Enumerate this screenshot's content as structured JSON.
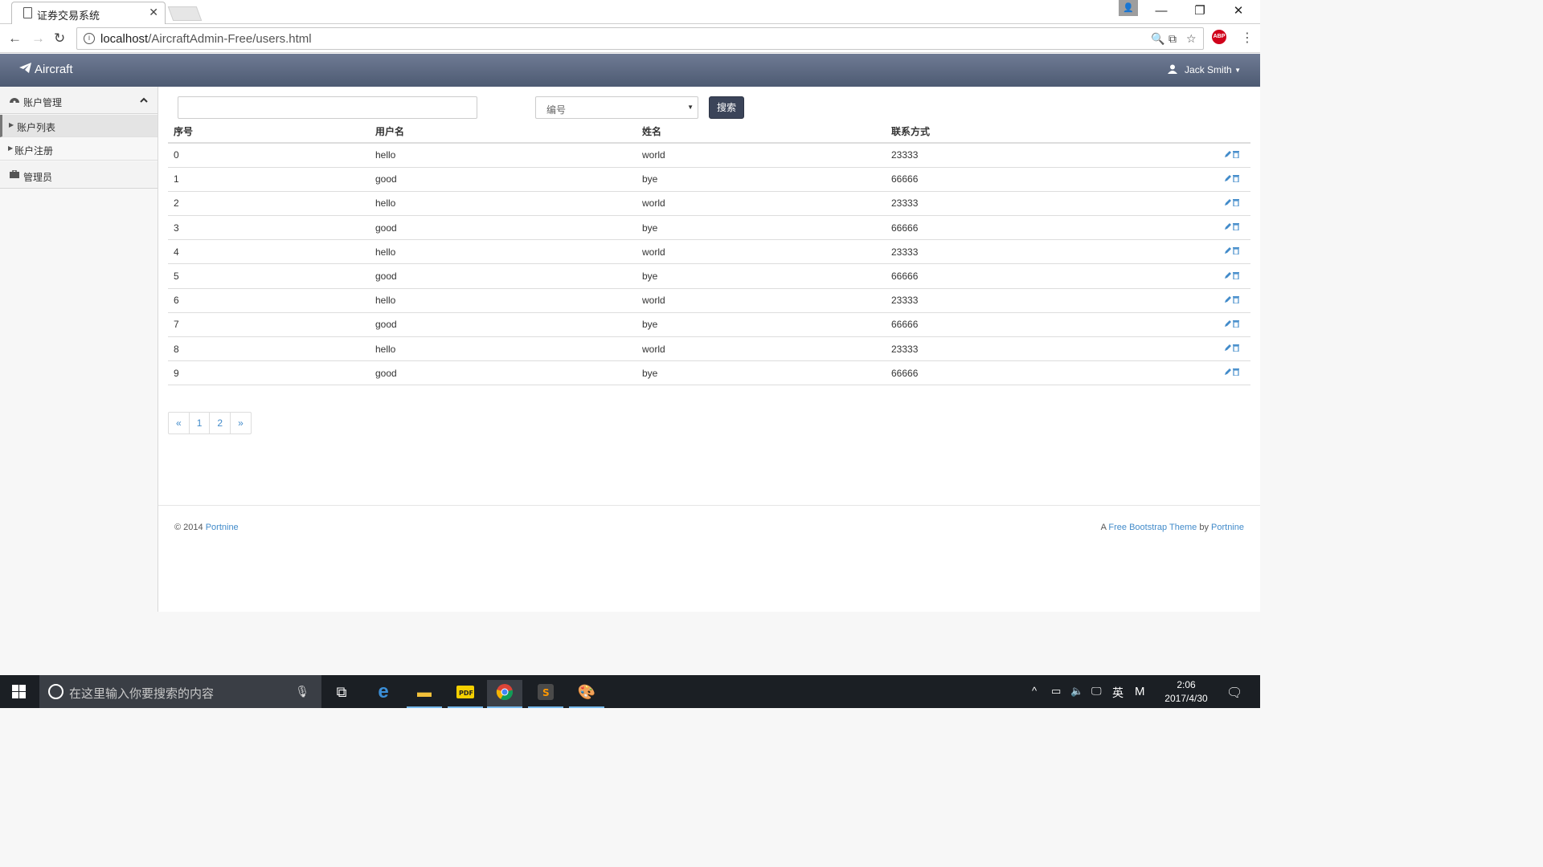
{
  "browser": {
    "tab_title": "证券交易系统",
    "url_host": "localhost",
    "url_path": "/AircraftAdmin-Free/users.html"
  },
  "header": {
    "brand": "Aircraft",
    "user_name": "Jack Smith"
  },
  "sidebar": {
    "groups": [
      {
        "label": "账户管理",
        "items": [
          {
            "label": "账户列表",
            "active": true
          },
          {
            "label": "账户注册",
            "active": false
          }
        ]
      },
      {
        "label": "管理员"
      }
    ]
  },
  "search": {
    "input_value": "",
    "select_value": "编号",
    "button_label": "搜索"
  },
  "table": {
    "headers": [
      "序号",
      "用户名",
      "姓名",
      "联系方式"
    ],
    "rows": [
      [
        "0",
        "hello",
        "world",
        "23333"
      ],
      [
        "1",
        "good",
        "bye",
        "66666"
      ],
      [
        "2",
        "hello",
        "world",
        "23333"
      ],
      [
        "3",
        "good",
        "bye",
        "66666"
      ],
      [
        "4",
        "hello",
        "world",
        "23333"
      ],
      [
        "5",
        "good",
        "bye",
        "66666"
      ],
      [
        "6",
        "hello",
        "world",
        "23333"
      ],
      [
        "7",
        "good",
        "bye",
        "66666"
      ],
      [
        "8",
        "hello",
        "world",
        "23333"
      ],
      [
        "9",
        "good",
        "bye",
        "66666"
      ]
    ]
  },
  "pagination": [
    "«",
    "1",
    "2",
    "»"
  ],
  "footer": {
    "copyright": "© 2014",
    "left_link": "Portnine",
    "right_prefix": "A",
    "right_link1": "Free Bootstrap Theme",
    "right_by": "by",
    "right_link2": "Portnine"
  },
  "taskbar": {
    "search_placeholder": "在这里输入你要搜索的内容",
    "ime": "英",
    "ime2": "M",
    "time": "2:06",
    "date": "2017/4/30"
  },
  "colors": {
    "header_bg": "#5a6680",
    "link": "#428bca",
    "button_dark": "#3b4459"
  }
}
